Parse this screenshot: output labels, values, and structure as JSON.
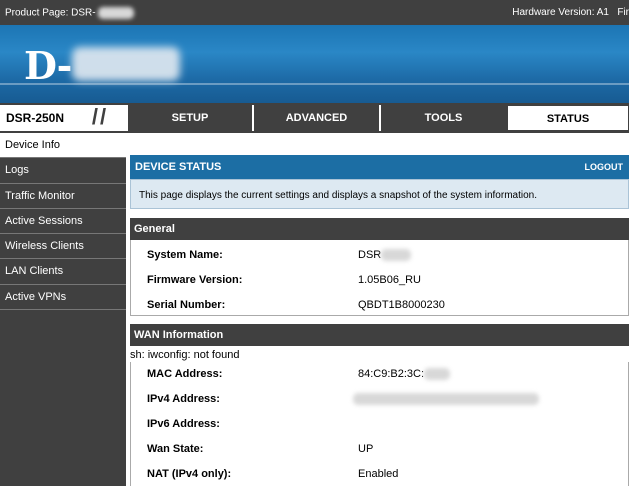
{
  "topbar": {
    "product_label": "Product Page: DSR-",
    "hardware_label": "Hardware Version: A1",
    "firmware_label": "Fir"
  },
  "banner": {
    "logo_text": "D-"
  },
  "nav": {
    "model": "DSR-250N",
    "tabs": [
      {
        "label": "SETUP"
      },
      {
        "label": "ADVANCED"
      },
      {
        "label": "TOOLS"
      },
      {
        "label": "STATUS",
        "active": true
      }
    ]
  },
  "sidebar": {
    "items": [
      {
        "label": "Device Info",
        "active": true
      },
      {
        "label": "Logs"
      },
      {
        "label": "Traffic Monitor"
      },
      {
        "label": "Active Sessions"
      },
      {
        "label": "Wireless Clients"
      },
      {
        "label": "LAN Clients"
      },
      {
        "label": "Active VPNs"
      }
    ]
  },
  "main": {
    "title": "DEVICE STATUS",
    "logout": "LOGOUT",
    "description": "This page displays the current settings and displays a snapshot of the system information.",
    "general": {
      "heading": "General",
      "rows": [
        {
          "label": "System Name:",
          "value": "DSR"
        },
        {
          "label": "Firmware Version:",
          "value": "1.05B06_RU"
        },
        {
          "label": "Serial Number:",
          "value": "QBDT1B8000230"
        }
      ]
    },
    "wan": {
      "heading": "WAN Information",
      "error": "sh: iwconfig: not found",
      "rows": [
        {
          "label": "MAC Address:",
          "value": "84:C9:B2:3C:"
        },
        {
          "label": "IPv4 Address:",
          "value": ""
        },
        {
          "label": "IPv6 Address:",
          "value": ""
        },
        {
          "label": "Wan State:",
          "value": "UP"
        },
        {
          "label": "NAT (IPv4 only):",
          "value": "Enabled"
        }
      ]
    }
  },
  "colors": {
    "dark": "#404040",
    "header_blue": "#1c6ea4",
    "banner_blue": "#2a87c6",
    "desc_bg": "#dde9f2"
  }
}
